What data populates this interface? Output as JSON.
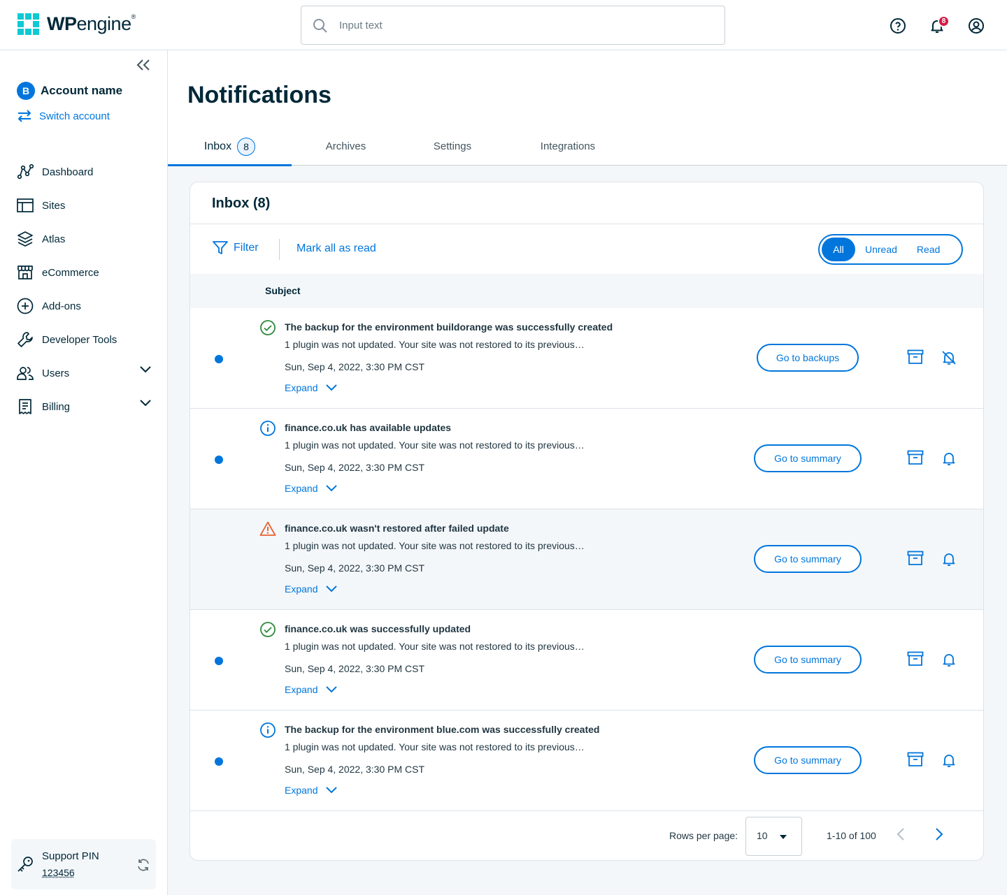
{
  "header": {
    "logo_bold": "WP",
    "logo_light": "engine",
    "logo_mark": "®",
    "search_placeholder": "Input text",
    "notification_count": "8"
  },
  "sidebar": {
    "account_initial": "B",
    "account_name": "Account name",
    "switch_account": "Switch account",
    "items": [
      {
        "label": "Dashboard",
        "icon": "dashboard-icon"
      },
      {
        "label": "Sites",
        "icon": "sites-icon"
      },
      {
        "label": "Atlas",
        "icon": "atlas-icon"
      },
      {
        "label": "eCommerce",
        "icon": "store-icon"
      },
      {
        "label": "Add-ons",
        "icon": "plus-circle-icon"
      },
      {
        "label": "Developer Tools",
        "icon": "wrench-icon"
      },
      {
        "label": "Users",
        "icon": "users-icon"
      },
      {
        "label": "Billing",
        "icon": "billing-icon"
      }
    ],
    "support_label": "Support PIN",
    "support_pin": "123456"
  },
  "main": {
    "title": "Notifications",
    "tabs": [
      {
        "label": "Inbox",
        "count": "8"
      },
      {
        "label": "Archives"
      },
      {
        "label": "Settings"
      },
      {
        "label": "Integrations"
      }
    ],
    "card_title": "Inbox (8)",
    "filter_label": "Filter",
    "mark_all_label": "Mark all as read",
    "segment": {
      "all": "All",
      "unread": "Unread",
      "read": "Read"
    },
    "column_subject": "Subject",
    "rows": [
      {
        "subject": "The backup for the environment buildorange was successfully created",
        "desc": "1 plugin was not updated. Your site was not restored to its previous…",
        "date": "Sun, Sep 4, 2022, 3:30 PM CST",
        "expand": "Expand",
        "action": "Go to backups",
        "status": "success-icon",
        "unread": true
      },
      {
        "subject": "finance.co.uk has available updates",
        "desc": "1 plugin was not updated. Your site was not restored to its previous…",
        "date": "Sun, Sep 4, 2022, 3:30 PM CST",
        "expand": "Expand",
        "action": "Go to summary",
        "status": "info-icon",
        "unread": true
      },
      {
        "subject": "finance.co.uk wasn't restored after failed update",
        "desc": "1 plugin was not updated. Your site was not restored to its previous…",
        "date": "Sun, Sep 4, 2022, 3:30 PM CST",
        "expand": "Expand",
        "action": "Go to summary",
        "status": "warning-icon",
        "unread": false
      },
      {
        "subject": "finance.co.uk was successfully updated",
        "desc": "1 plugin was not updated. Your site was not restored to its previous…",
        "date": "Sun, Sep 4, 2022, 3:30 PM CST",
        "expand": "Expand",
        "action": "Go to summary",
        "status": "success-icon",
        "unread": true
      },
      {
        "subject": "The backup for the environment blue.com was successfully created",
        "desc": "1 plugin was not updated. Your site was not restored to its previous…",
        "date": "Sun, Sep 4, 2022, 3:30 PM CST",
        "expand": "Expand",
        "action": "Go to summary",
        "status": "info-icon",
        "unread": true
      }
    ],
    "pager": {
      "rows_label": "Rows per page:",
      "rows_value": "10",
      "range": "1-10 of 100"
    }
  },
  "colors": {
    "accent": "#0076dc",
    "success": "#2e8a3c",
    "warning": "#e8602c",
    "badge": "#d21b46",
    "brand": "#0ecad4"
  }
}
